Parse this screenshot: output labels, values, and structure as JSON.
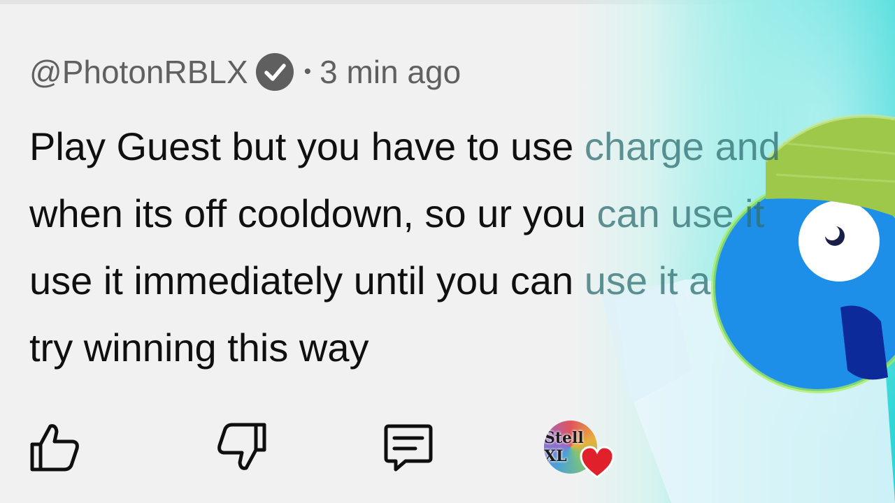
{
  "comment": {
    "handle": "@PhotonRBLX",
    "verified_icon": "verified-check-icon",
    "separator": "•",
    "timestamp": "3 min ago",
    "lines": [
      {
        "main": "Play Guest but you have to use ",
        "faded": "charge and"
      },
      {
        "main": "when its off cooldown, so ur you ",
        "faded": "can use it"
      },
      {
        "main": "use it immediately until you can ",
        "faded": "use it a"
      },
      {
        "main": "try winning this way",
        "faded": ""
      }
    ]
  },
  "actions": {
    "like_icon": "thumbs-up-icon",
    "dislike_icon": "thumbs-down-icon",
    "reply_icon": "reply-comment-icon",
    "creator_avatar_text": "Stell XL",
    "creator_heart_icon": "heart-icon"
  },
  "colors": {
    "background": "#f1f1f1",
    "meta_text": "#606060",
    "body_text": "#0f0f0f",
    "heart": "#e0202a",
    "accent_cyan": "#2fd6d6"
  }
}
